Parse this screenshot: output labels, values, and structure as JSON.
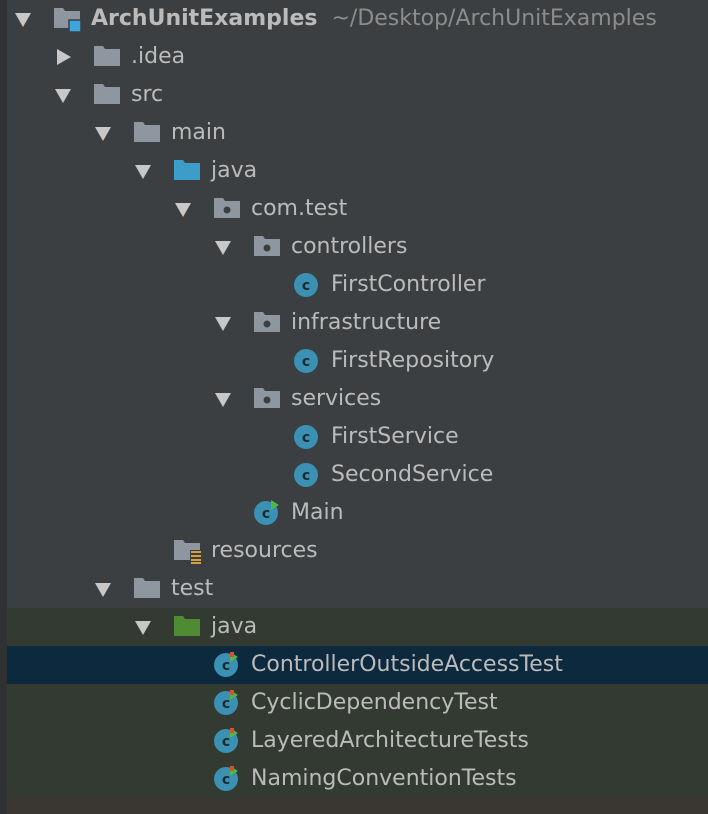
{
  "colors": {
    "background": "#3c3f41",
    "folder": "#8e97a0",
    "source_folder": "#3d9dc9",
    "test_folder": "#4e8b34",
    "class_icon": "#3b91b3",
    "selection": "#0d293e",
    "test_area": "#333a31"
  },
  "tree": [
    {
      "label": "ArchUnitExamples",
      "hint": "~/Desktop/ArchUnitExamples",
      "level": 0,
      "expanded": true,
      "icon": "project-folder-icon",
      "bold": true,
      "bg": ""
    },
    {
      "label": ".idea",
      "level": 1,
      "expanded": false,
      "icon": "folder-icon",
      "bg": ""
    },
    {
      "label": "src",
      "level": 1,
      "expanded": true,
      "icon": "folder-icon",
      "bg": ""
    },
    {
      "label": "main",
      "level": 2,
      "expanded": true,
      "icon": "folder-icon",
      "bg": ""
    },
    {
      "label": "java",
      "level": 3,
      "expanded": true,
      "icon": "source-folder-icon",
      "bg": ""
    },
    {
      "label": "com.test",
      "level": 4,
      "expanded": true,
      "icon": "package-icon",
      "bg": ""
    },
    {
      "label": "controllers",
      "level": 5,
      "expanded": true,
      "icon": "package-icon",
      "bg": ""
    },
    {
      "label": "FirstController",
      "level": 6,
      "icon": "class-icon",
      "bg": ""
    },
    {
      "label": "infrastructure",
      "level": 5,
      "expanded": true,
      "icon": "package-icon",
      "bg": ""
    },
    {
      "label": "FirstRepository",
      "level": 6,
      "icon": "class-icon",
      "bg": ""
    },
    {
      "label": "services",
      "level": 5,
      "expanded": true,
      "icon": "package-icon",
      "bg": ""
    },
    {
      "label": "FirstService",
      "level": 6,
      "icon": "class-icon",
      "bg": ""
    },
    {
      "label": "SecondService",
      "level": 6,
      "icon": "class-icon",
      "bg": ""
    },
    {
      "label": "Main",
      "level": 5,
      "icon": "main-class-icon",
      "bg": ""
    },
    {
      "label": "resources",
      "level": 3,
      "icon": "resources-folder-icon",
      "bg": ""
    },
    {
      "label": "test",
      "level": 2,
      "expanded": true,
      "icon": "folder-icon",
      "bg": ""
    },
    {
      "label": "java",
      "level": 3,
      "expanded": true,
      "icon": "test-folder-icon",
      "bg": "test"
    },
    {
      "label": "ControllerOutsideAccessTest",
      "level": 4,
      "icon": "test-class-icon",
      "bg": "selected"
    },
    {
      "label": "CyclicDependencyTest",
      "level": 4,
      "icon": "test-class-icon",
      "bg": "test"
    },
    {
      "label": "LayeredArchitectureTests",
      "level": 4,
      "icon": "test-class-icon",
      "bg": "test"
    },
    {
      "label": "NamingConventionTests",
      "level": 4,
      "icon": "test-class-icon",
      "bg": "test"
    }
  ]
}
